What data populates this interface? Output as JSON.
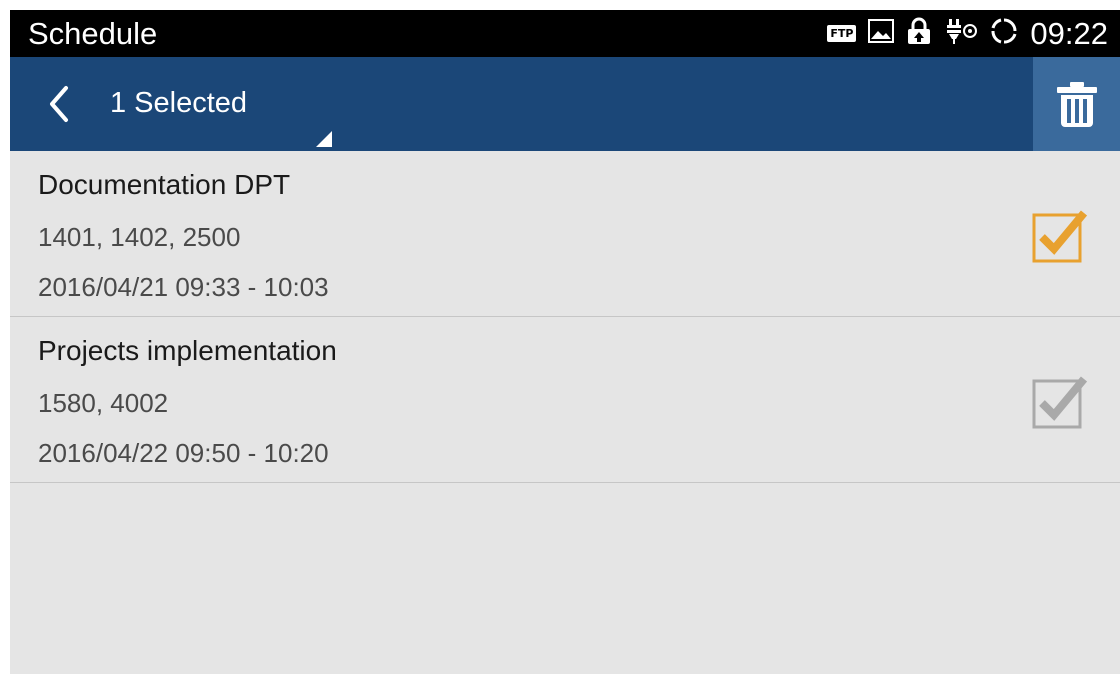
{
  "status_bar": {
    "app_title": "Schedule",
    "ftp_label": "FTP",
    "time": "09:22",
    "icons": [
      "ftp-icon",
      "image-icon",
      "lock-icon",
      "usb-debug-icon",
      "sync-icon"
    ]
  },
  "action_bar": {
    "selection_label": "1 Selected",
    "back_icon": "chevron-left-icon",
    "delete_icon": "trash-icon"
  },
  "colors": {
    "action_bar": "#1b4778",
    "delete_button": "#3a6a9c",
    "checked": "#e8a12f",
    "unchecked": "#a9a9a9",
    "list_background": "#e5e5e5"
  },
  "schedules": [
    {
      "title": "Documentation DPT",
      "members": "1401, 1402, 2500",
      "time": "2016/04/21 09:33 - 10:03",
      "checked": true
    },
    {
      "title": "Projects implementation",
      "members": "1580, 4002",
      "time": "2016/04/22 09:50 - 10:20",
      "checked": false
    }
  ]
}
